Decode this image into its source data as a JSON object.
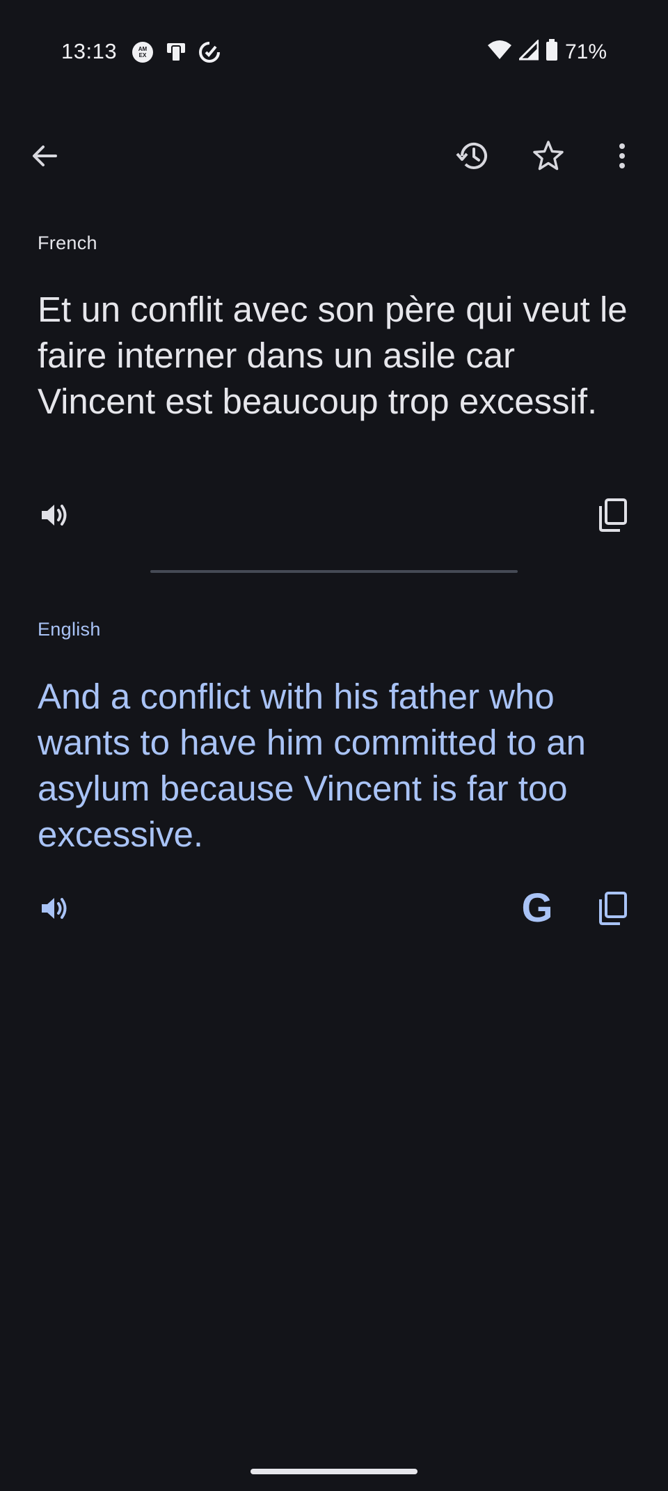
{
  "status_bar": {
    "time": "13:13",
    "battery": "71%",
    "left_icons": [
      "amex-icon",
      "cast-phone-icon",
      "sync-check-icon"
    ],
    "right_icons": [
      "wifi-icon",
      "signal-icon",
      "battery-icon"
    ]
  },
  "app_bar": {
    "icons": [
      "back-arrow-icon",
      "history-icon",
      "star-icon",
      "more-vert-icon"
    ]
  },
  "source": {
    "language": "French",
    "text": "Et un conflit avec son père qui veut le faire interner dans un asile car Vincent est beaucoup trop excessif."
  },
  "target": {
    "language": "English",
    "text": "And a conflict with his father who wants to have him committed to an asylum because Vincent is far too excessive."
  },
  "google_icon_text": "G",
  "colors": {
    "background": "#131419",
    "source_text": "#e6e6eb",
    "target_accent": "#a9c3f6",
    "divider": "#454a55"
  }
}
